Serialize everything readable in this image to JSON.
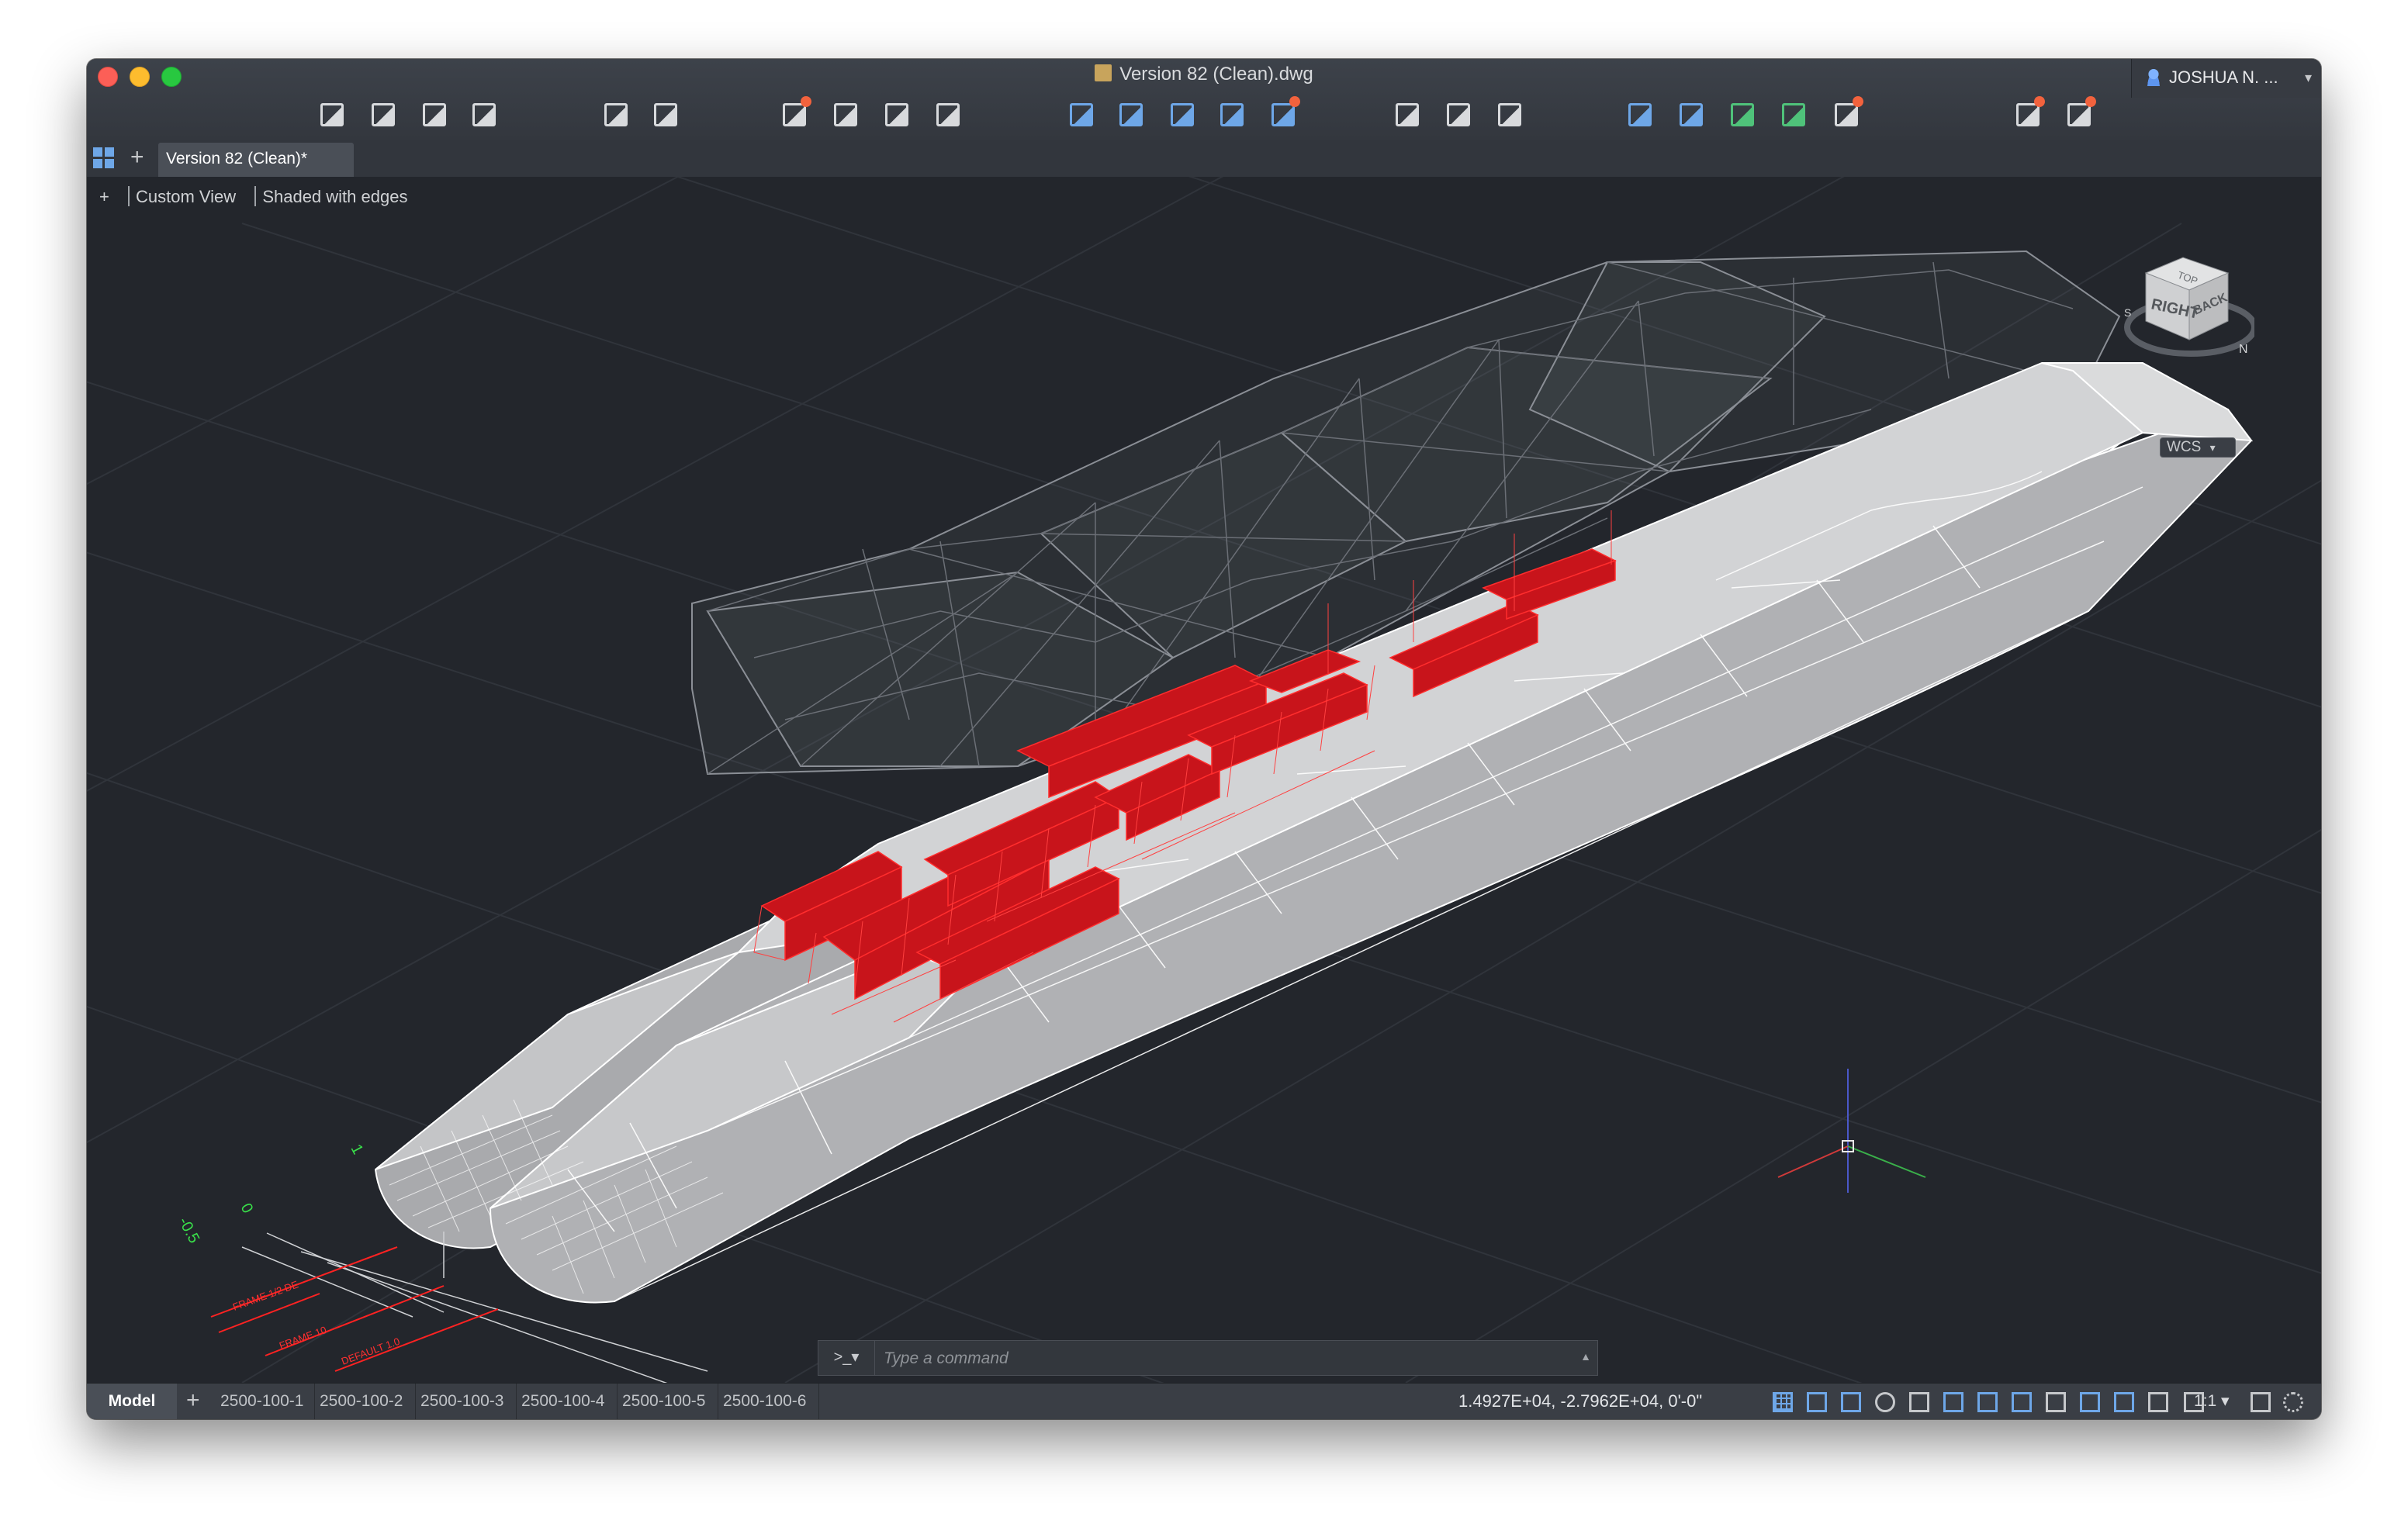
{
  "window": {
    "title": "Version 82 (Clean).dwg",
    "user_name": "JOSHUA N. ...",
    "user_caret": "▾"
  },
  "toolbar": {
    "icons": [
      {
        "name": "new-file-icon",
        "color": "#d8dadd"
      },
      {
        "name": "open-folder-icon",
        "color": "#d8dadd"
      },
      {
        "name": "save-icon",
        "color": "#d8dadd"
      },
      {
        "name": "save-as-icon",
        "color": "#d8dadd"
      },
      {
        "name": "undo-icon",
        "color": "#d8dadd"
      },
      {
        "name": "redo-icon",
        "color": "#d8dadd"
      },
      {
        "name": "plot-icon",
        "color": "#d8dadd",
        "badge": true
      },
      {
        "name": "print-icon",
        "color": "#d8dadd"
      },
      {
        "name": "batch-plot-icon",
        "color": "#d8dadd"
      },
      {
        "name": "page-setup-icon",
        "color": "#d8dadd"
      },
      {
        "name": "publish-icon",
        "color": "#6ea7e8"
      },
      {
        "name": "export-icon",
        "color": "#6ea7e8"
      },
      {
        "name": "xref-icon",
        "color": "#6ea7e8"
      },
      {
        "name": "attach-icon",
        "color": "#6ea7e8"
      },
      {
        "name": "layers-icon",
        "color": "#6ea7e8",
        "badge": true
      },
      {
        "name": "zoom-window-icon",
        "color": "#d8dadd"
      },
      {
        "name": "pan-hand-icon",
        "color": "#d8dadd"
      },
      {
        "name": "orbit-icon",
        "color": "#d8dadd"
      },
      {
        "name": "properties-icon",
        "color": "#6ea7e8"
      },
      {
        "name": "match-properties-icon",
        "color": "#6ea7e8"
      },
      {
        "name": "insert-block-icon",
        "color": "#4fc27a"
      },
      {
        "name": "group-icon",
        "color": "#4fc27a"
      },
      {
        "name": "purge-icon",
        "color": "#d8dadd",
        "badge": true
      },
      {
        "name": "render-icon",
        "color": "#d8dadd",
        "badge": true
      },
      {
        "name": "visual-style-icon",
        "color": "#d8dadd",
        "badge": true
      }
    ]
  },
  "tabs": {
    "document_tab": "Version 82 (Clean)*",
    "add_symbol": "+"
  },
  "viewport": {
    "controls_plus": "+",
    "view_name": "Custom View",
    "visual_style": "Shaded with edges",
    "viewcube": {
      "top_face": "TOP",
      "right_face": "RIGHT",
      "back_face": "BACK",
      "compass_n": "N",
      "compass_s": "S"
    },
    "ucs_label": "WCS",
    "ucs_caret": "▾",
    "dimension_labels": [
      "1",
      "0",
      "-0.5"
    ],
    "red_labels": [
      "FRAME 1/2 DE",
      "FRAME 10",
      "DEFAULT 1.0"
    ]
  },
  "command_line": {
    "prompt_glyph": ">_▾",
    "placeholder": "Type a command",
    "expand_glyph": "▲"
  },
  "statusbar": {
    "model_tab": "Model",
    "add_layout": "+",
    "layouts": [
      "2500-100-1",
      "2500-100-2",
      "2500-100-3",
      "2500-100-4",
      "2500-100-5",
      "2500-100-6"
    ],
    "coordinates": "1.4927E+04,   -2.7962E+04, 0'-0\"",
    "scale": "1:1 ▾",
    "icons": [
      {
        "name": "grid-icon",
        "active": true
      },
      {
        "name": "snap-icon",
        "active": true
      },
      {
        "name": "ortho-icon",
        "active": true
      },
      {
        "name": "polar-icon",
        "active": false
      },
      {
        "name": "osnap-icon",
        "active": false
      },
      {
        "name": "lineweight-icon",
        "active": true
      },
      {
        "name": "transparency-icon",
        "active": true
      },
      {
        "name": "selection-cycling-icon",
        "active": true
      },
      {
        "name": "dynamic-ucs-icon",
        "active": false
      },
      {
        "name": "3d-osnap-icon",
        "active": true
      },
      {
        "name": "annotation-visibility-icon",
        "active": true
      },
      {
        "name": "auto-scale-icon",
        "active": false
      },
      {
        "name": "annotation-scale-icon",
        "active": false
      },
      {
        "name": "workspace-icon",
        "active": false
      },
      {
        "name": "settings-gear-icon",
        "active": false
      }
    ]
  }
}
